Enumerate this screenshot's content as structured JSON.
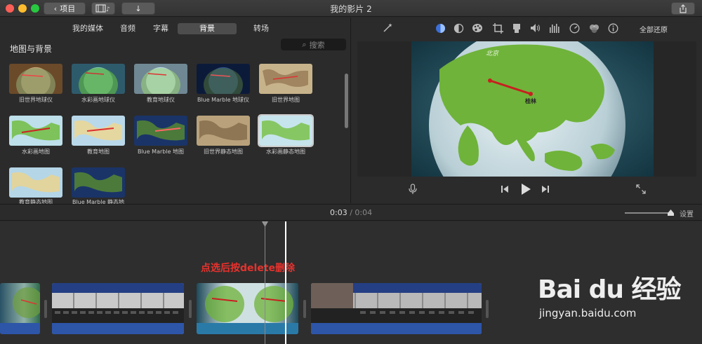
{
  "window": {
    "title": "我的影片 2",
    "back_label": "项目"
  },
  "browser_tabs": [
    {
      "label": "我的媒体",
      "active": false
    },
    {
      "label": "音频",
      "active": false
    },
    {
      "label": "字幕",
      "active": false
    },
    {
      "label": "背景",
      "active": true
    },
    {
      "label": "转场",
      "active": false
    }
  ],
  "library": {
    "section_title": "地图与背景",
    "search_placeholder": "搜索",
    "items": [
      {
        "label": "旧世界地球仪",
        "style": "old-globe"
      },
      {
        "label": "水彩画地球仪",
        "style": "watercolor-globe"
      },
      {
        "label": "教育地球仪",
        "style": "edu-globe"
      },
      {
        "label": "Blue Marble 地球仪",
        "style": "marble-globe"
      },
      {
        "label": "旧世界地图",
        "style": "old-map"
      },
      {
        "label": "水彩画地图",
        "style": "watercolor-map"
      },
      {
        "label": "教育地图",
        "style": "edu-map"
      },
      {
        "label": "Blue Marble 地图",
        "style": "marble-map"
      },
      {
        "label": "旧世界静态地图",
        "style": "old-static"
      },
      {
        "label": "水彩画静态地图",
        "style": "watercolor-static"
      },
      {
        "label": "教育静态地图",
        "style": "edu-static"
      },
      {
        "label": "Blue Marble 静态地",
        "style": "marble-static"
      }
    ]
  },
  "viewer": {
    "reset_label": "全部还原",
    "map_labels": {
      "region": "北京",
      "city": "桂林"
    }
  },
  "timeline": {
    "current_time": "0:03",
    "separator": "/",
    "total_time": "0:04",
    "settings_label": "设置",
    "annotation": "点选后按delete删除"
  },
  "watermark": {
    "logo": "Bai du 经验",
    "url": "jingyan.baidu.com"
  },
  "colors": {
    "accent_blue": "#3b6fd8",
    "annotation_red": "#e8322d",
    "audio_blue": "#2d55a8"
  }
}
